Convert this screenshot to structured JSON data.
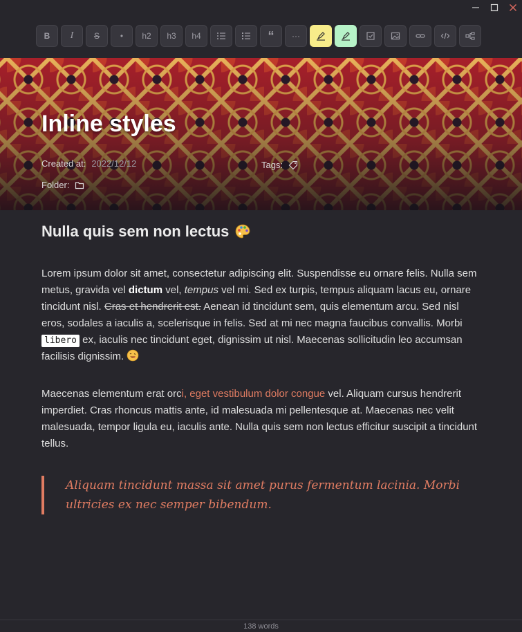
{
  "window": {
    "minimize_icon": "minimize-icon",
    "maximize_icon": "maximize-icon",
    "close_icon": "close-icon"
  },
  "toolbar": {
    "buttons": [
      {
        "name": "bold",
        "label": "B"
      },
      {
        "name": "italic",
        "label": "I"
      },
      {
        "name": "strikethrough",
        "label": "S"
      },
      {
        "name": "bullet",
        "label": "•"
      },
      {
        "name": "h2",
        "label": "h2"
      },
      {
        "name": "h3",
        "label": "h3"
      },
      {
        "name": "h4",
        "label": "h4"
      },
      {
        "name": "bullet-list",
        "icon": "bullet-list-icon"
      },
      {
        "name": "numbered-list",
        "icon": "numbered-list-icon"
      },
      {
        "name": "quote",
        "label": "“"
      },
      {
        "name": "divider",
        "label": "···"
      },
      {
        "name": "highlight-yellow",
        "icon": "highlighter-icon"
      },
      {
        "name": "highlight-green",
        "icon": "highlighter-icon"
      },
      {
        "name": "checkbox",
        "icon": "checkbox-icon"
      },
      {
        "name": "image",
        "icon": "image-icon"
      },
      {
        "name": "link",
        "icon": "link-icon"
      },
      {
        "name": "code",
        "icon": "code-icon"
      },
      {
        "name": "embed",
        "icon": "embed-icon"
      }
    ],
    "colors": {
      "highlight_yellow": "#f7ec8a",
      "highlight_green": "#b6f2c7"
    }
  },
  "note": {
    "title": "Inline styles",
    "created_label": "Created at:",
    "created_value": "2022/12/12",
    "tags_label": "Tags:",
    "folder_label": "Folder:",
    "heading": "Nulla quis sem non lectus",
    "heading_emoji": "palette-emoji",
    "p1": {
      "a": "Lorem ipsum dolor sit amet, consectetur adipiscing elit. Suspendisse eu ornare felis. Nulla sem metus, gravida vel ",
      "bold": "dictum",
      "b": " vel, ",
      "italic": "tempus",
      "c": " vel mi. Sed ex turpis, tempus aliquam lacus eu, ornare tincidunt nisl. ",
      "strike": "Cras et hendrerit est.",
      "d": " Aenean id tincidunt sem, quis elementum arcu. Sed nisl eros, sodales a iaculis a, scelerisque in felis. Sed at mi nec magna faucibus convallis. Morbi ",
      "code": "libero",
      "e": " ex, iaculis nec tincidunt eget, dignissim ut nisl. Maecenas sollicitudin leo accumsan facilisis dignissim. "
    },
    "p2": {
      "a": "Maecenas elementum erat orc",
      "link": "i, eget vestibulum dolor congue",
      "b": " vel. Aliquam cursus hendrerit imperdiet. Cras rhoncus mattis ante, id malesuada mi pellentesque at. Maecenas nec velit malesuada, tempor ligula eu, iaculis ante. Nulla quis sem non lectus efficitur suscipit a tincidunt tellus."
    },
    "quote": "Aliquam tincidunt massa sit amet purus fermentum lacinia. Morbi ultricies ex nec semper bibendum.",
    "accent_color": "#e07c62"
  },
  "status": {
    "word_count": "138 words"
  }
}
